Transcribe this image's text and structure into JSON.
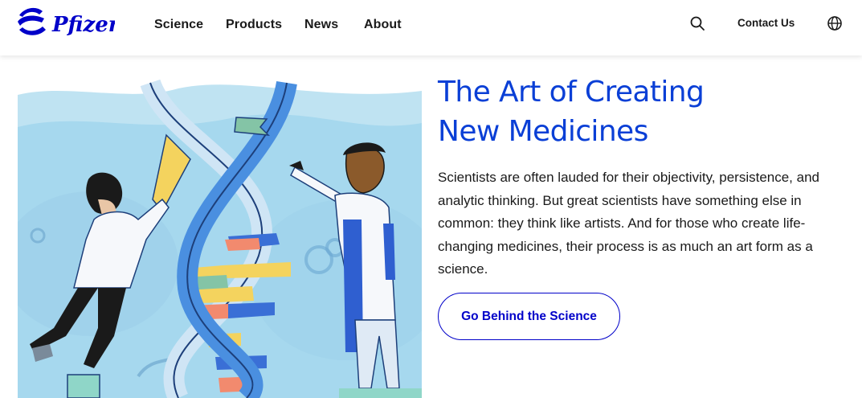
{
  "brand": {
    "logo_text": "Pfizer",
    "color": "#0000c9"
  },
  "nav": {
    "items": [
      {
        "label": "Science"
      },
      {
        "label": "Products"
      },
      {
        "label": "News"
      },
      {
        "label": "About"
      }
    ]
  },
  "utility": {
    "search_icon": "search-icon",
    "contact_label": "Contact Us",
    "globe_icon": "globe-icon"
  },
  "hero": {
    "title_line1": "The Art of Creating",
    "title_line2": "New Medicines",
    "description": "Scientists are often lauded for their objectivity, persistence, and analytic thinking. But great scientists have something else in common: they think like artists. And for those who create life-changing medicines, their process is as much an art form as a science.",
    "cta_label": "Go Behind the Science",
    "title_color": "#0a3fd6",
    "image_subject": "illustration of two scientists painting a DNA double helix"
  }
}
